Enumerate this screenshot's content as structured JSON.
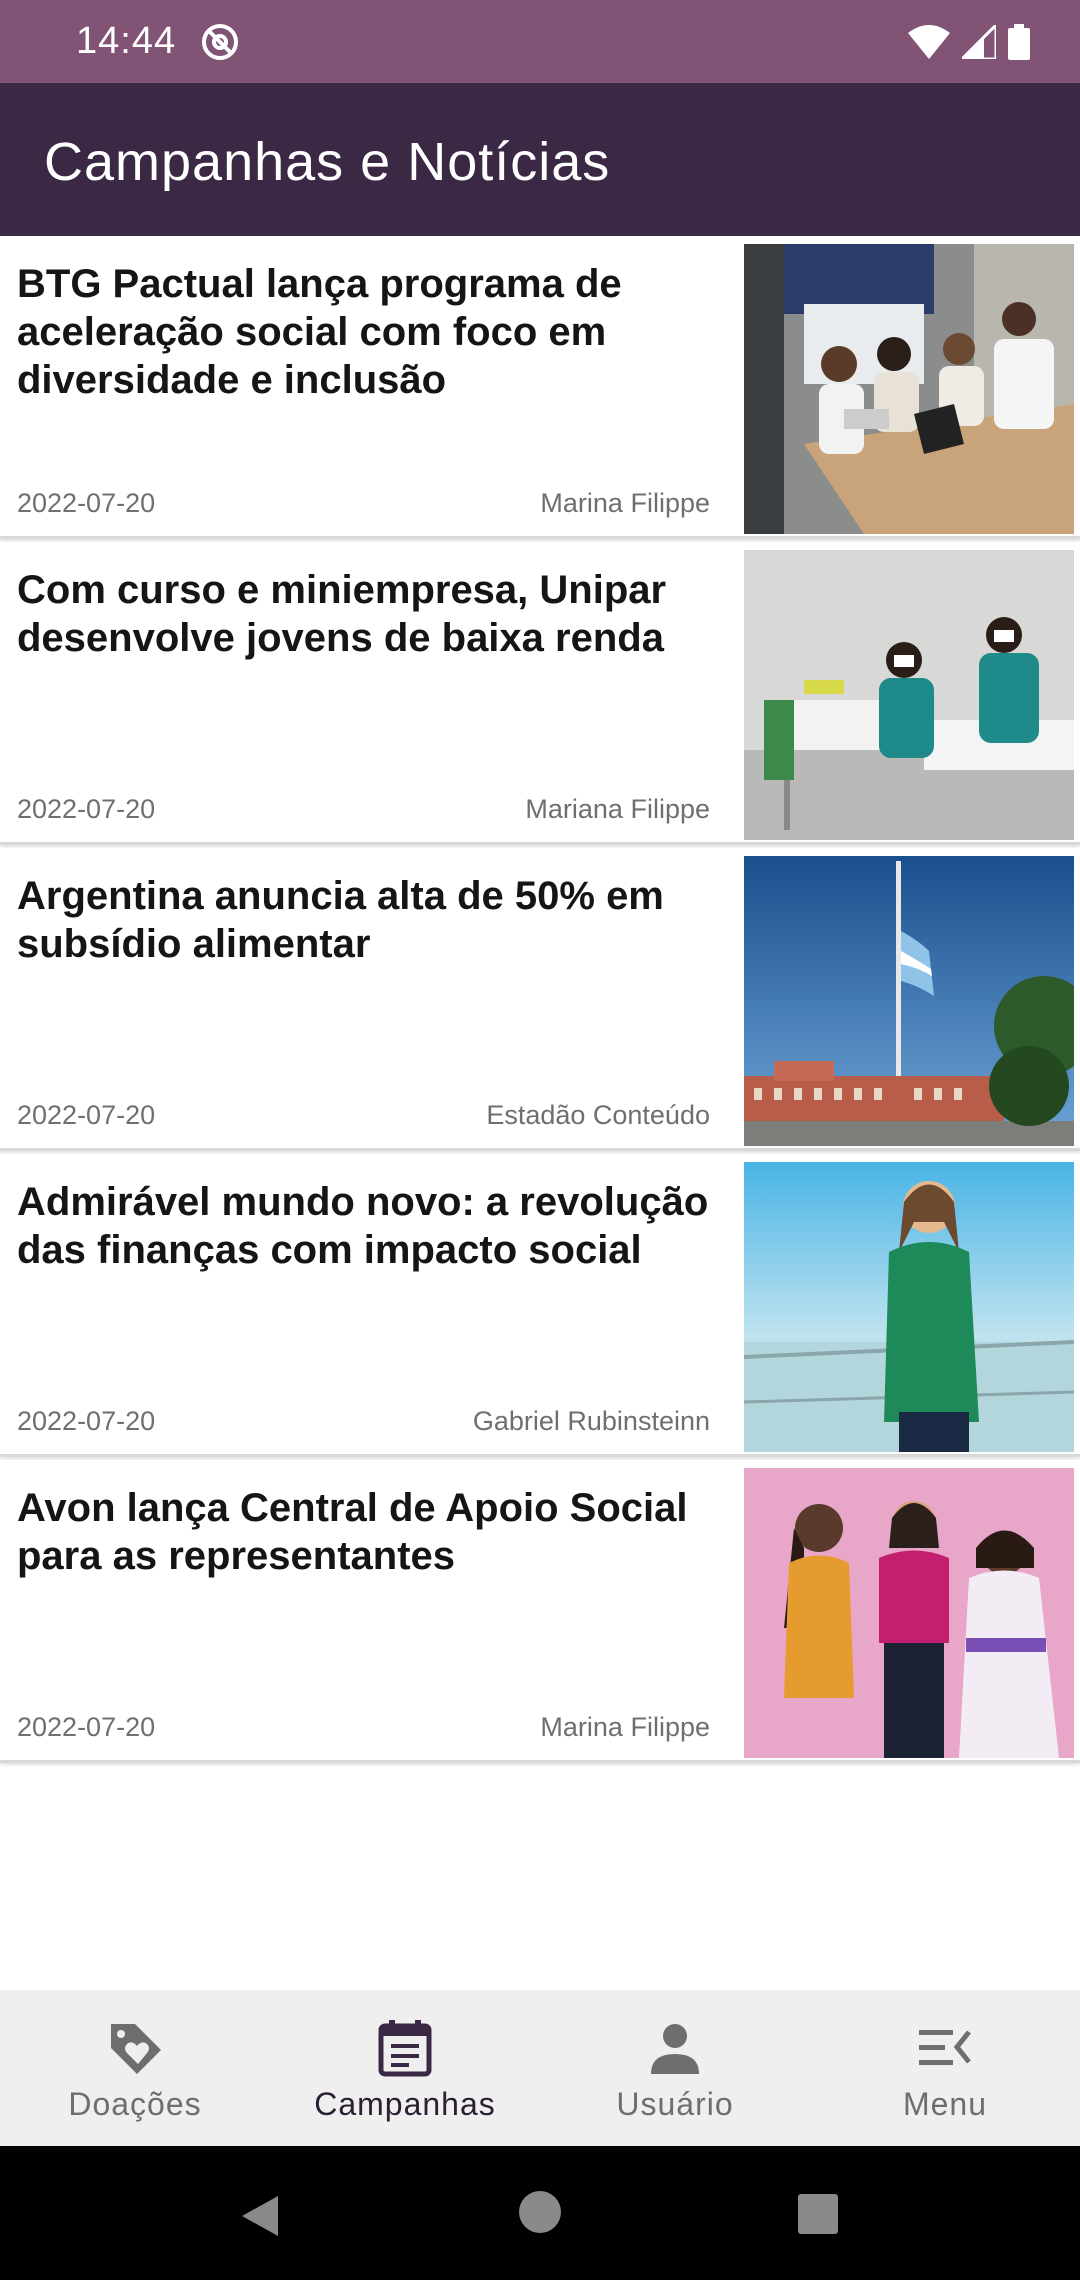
{
  "status_bar": {
    "time": "14:44",
    "icons": [
      "dnd-icon",
      "wifi-icon",
      "cell-signal-icon",
      "battery-icon"
    ]
  },
  "app_bar": {
    "title": "Campanhas e Notícias",
    "color": "#3b2845"
  },
  "news": [
    {
      "title": "BTG Pactual lança programa de aceleração social com foco em diversidade e inclusão",
      "date": "2022-07-20",
      "author": "Marina Filippe",
      "image": "meeting-photo"
    },
    {
      "title": "Com curso e miniempresa, Unipar desenvolve jovens de baixa renda",
      "date": "2022-07-20",
      "author": "Mariana Filippe",
      "image": "classroom-photo"
    },
    {
      "title": "Argentina anuncia alta de 50% em subsídio alimentar",
      "date": "2022-07-20",
      "author": "Estadão Conteúdo",
      "image": "flag-photo"
    },
    {
      "title": "Admirável mundo novo: a revolução das finanças com impacto social",
      "date": "2022-07-20",
      "author": "Gabriel Rubinsteinn",
      "image": "woman-balcony-photo"
    },
    {
      "title": "Avon lança Central de Apoio Social para as representantes",
      "date": "2022-07-20",
      "author": "Marina Filippe",
      "image": "women-group-photo"
    }
  ],
  "bottom_nav": {
    "items": [
      {
        "label": "Doações",
        "icon": "tag-heart-icon"
      },
      {
        "label": "Campanhas",
        "icon": "calendar-icon",
        "active": true
      },
      {
        "label": "Usuário",
        "icon": "person-icon"
      },
      {
        "label": "Menu",
        "icon": "menu-icon"
      }
    ]
  }
}
